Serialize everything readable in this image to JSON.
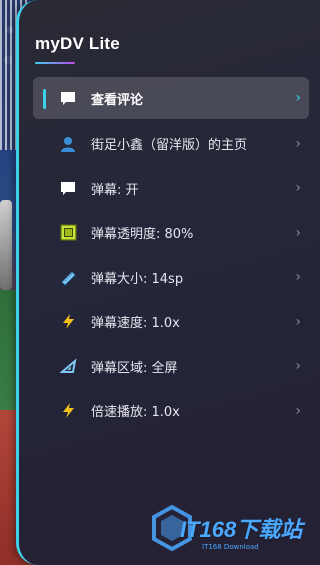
{
  "app": {
    "title": "myDV Lite"
  },
  "menu": {
    "items": [
      {
        "label": "查看评论",
        "icon": "comment-icon",
        "active": true
      },
      {
        "label": "街足小鑫（留洋版）的主页",
        "icon": "user-icon",
        "active": false
      },
      {
        "label": "弹幕: 开",
        "icon": "danmaku-icon",
        "active": false
      },
      {
        "label": "弹幕透明度: 80%",
        "icon": "opacity-icon",
        "active": false
      },
      {
        "label": "弹幕大小: 14sp",
        "icon": "ruler-icon",
        "active": false
      },
      {
        "label": "弹幕速度: 1.0x",
        "icon": "lightning-icon",
        "active": false
      },
      {
        "label": "弹幕区域: 全屏",
        "icon": "set-square-icon",
        "active": false
      },
      {
        "label": "倍速播放: 1.0x",
        "icon": "lightning-icon",
        "active": false
      }
    ],
    "chevron": "›"
  },
  "watermark": {
    "text": "IT168下载站",
    "subtext": "IT168 Download"
  },
  "colors": {
    "accent": "#3fd0ea",
    "panel_bg": "#25273a",
    "icon_blue": "#3b8fd8",
    "icon_yellow": "#f3c01a",
    "icon_green": "#c7e23a",
    "watermark_blue": "#4aa8ff"
  }
}
